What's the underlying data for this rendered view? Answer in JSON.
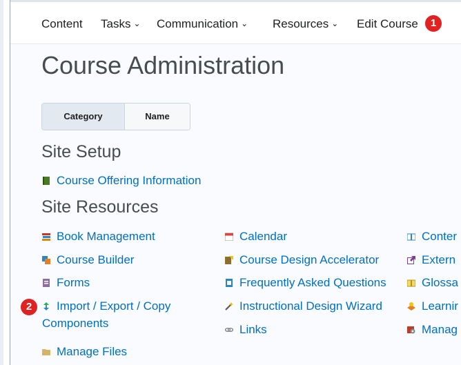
{
  "nav": {
    "items": [
      {
        "label": "Content",
        "has_menu": false
      },
      {
        "label": "Tasks",
        "has_menu": true
      },
      {
        "label": "Communication",
        "has_menu": true
      },
      {
        "label": "Resources",
        "has_menu": true
      },
      {
        "label": "Edit Course",
        "has_menu": false
      }
    ],
    "chevron": "⌄"
  },
  "badges": {
    "one": "1",
    "two": "2"
  },
  "page": {
    "title": "Course Administration"
  },
  "view_toggle": {
    "category": "Category",
    "name": "Name"
  },
  "sections": {
    "site_setup": {
      "title": "Site Setup",
      "items": [
        {
          "label": "Course Offering Information",
          "icon": "green-book-icon"
        }
      ]
    },
    "site_resources": {
      "title": "Site Resources",
      "col1": [
        {
          "label": "Book Management",
          "icon": "books-stack-icon"
        },
        {
          "label": "Course Builder",
          "icon": "course-builder-icon"
        },
        {
          "label": "Forms",
          "icon": "forms-icon"
        },
        {
          "label": "Import / Export / Copy",
          "label2": "Components",
          "icon": "import-export-icon"
        },
        {
          "label": "Manage Files",
          "icon": "folder-icon"
        }
      ],
      "col2": [
        {
          "label": "Calendar",
          "icon": "calendar-icon"
        },
        {
          "label": "Course Design Accelerator",
          "icon": "design-accelerator-icon"
        },
        {
          "label": "Frequently Asked Questions",
          "icon": "faq-icon"
        },
        {
          "label": "Instructional Design Wizard",
          "icon": "wizard-wand-icon"
        },
        {
          "label": "Links",
          "icon": "links-chain-icon"
        }
      ],
      "col3": [
        {
          "label": "Conter",
          "icon": "content-book-icon"
        },
        {
          "label": "Extern",
          "icon": "external-tools-icon"
        },
        {
          "label": "Glossa",
          "icon": "glossary-icon"
        },
        {
          "label": "Learnir",
          "icon": "learning-icon"
        },
        {
          "label": "Manag",
          "icon": "manage-gear-icon"
        }
      ]
    }
  },
  "colors": {
    "link": "#006fbf",
    "badge": "#e02222",
    "title": "#494c4e"
  }
}
